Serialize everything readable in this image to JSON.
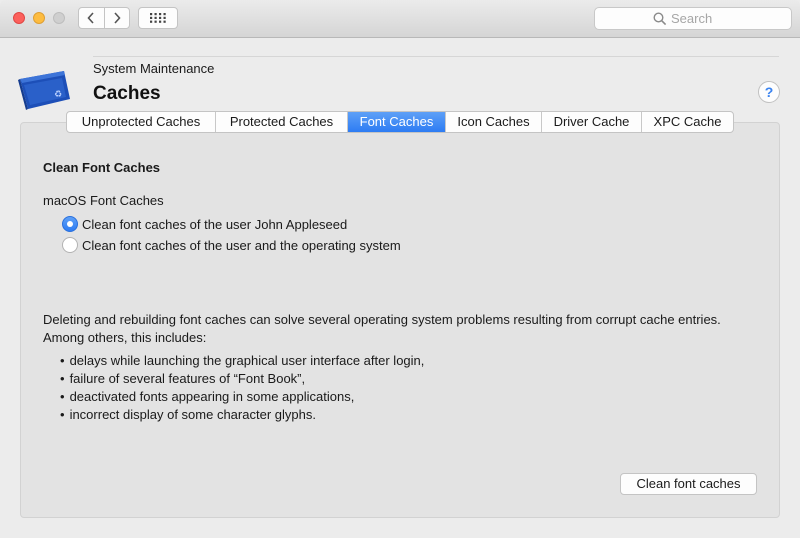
{
  "toolbar": {
    "search_placeholder": "Search"
  },
  "header": {
    "subtitle": "System Maintenance",
    "title": "Caches",
    "help_label": "?"
  },
  "tabs": [
    {
      "label": "Unprotected Caches",
      "active": false
    },
    {
      "label": "Protected Caches",
      "active": false
    },
    {
      "label": "Font Caches",
      "active": true
    },
    {
      "label": "Icon Caches",
      "active": false
    },
    {
      "label": "Driver Cache",
      "active": false
    },
    {
      "label": "XPC Cache",
      "active": false
    }
  ],
  "panel": {
    "section_title": "Clean Font Caches",
    "group_label": "macOS Font Caches",
    "options": [
      {
        "label": "Clean font caches of the user John Appleseed",
        "selected": true
      },
      {
        "label": "Clean font caches of the user and the operating system",
        "selected": false
      }
    ],
    "description": "Deleting and rebuilding font caches can solve several operating system problems resulting from corrupt cache entries. Among others, this includes:",
    "bullets": [
      "delays while launching the graphical user interface after login,",
      "failure of several features of “Font Book”,",
      "deactivated fonts appearing in some applications,",
      "incorrect display of some character glyphs."
    ],
    "action_label": "Clean font caches"
  },
  "colors": {
    "accent": "#2d7cf3",
    "close": "#fc605c",
    "minimize": "#fdbc40"
  }
}
